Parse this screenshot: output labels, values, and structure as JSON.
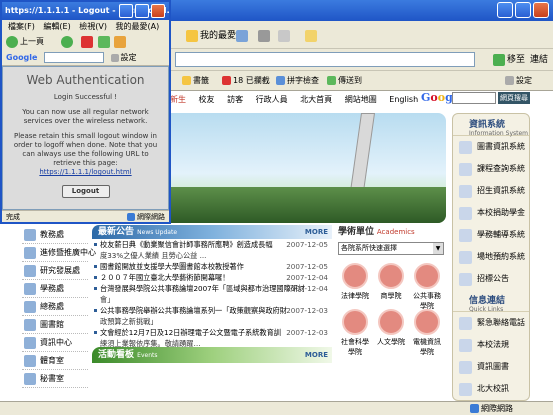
{
  "main_window": {
    "title": "",
    "toolbar": {
      "favorites": "我的最愛",
      "go": "移至",
      "links": "連結"
    },
    "links_bar": {
      "bookmarks": "書籤",
      "blocked": "18 已攔截",
      "spellcheck": "拼字檢查",
      "send_to": "傳送到",
      "settings": "設定"
    },
    "page": {
      "topnav": [
        "新生",
        "校友",
        "訪客",
        "行政人員",
        "北大首頁",
        "網站地圖",
        "English"
      ],
      "google_btn": "網頁搜尋",
      "news": {
        "title": "最新公告",
        "subtitle": "News Update",
        "more": "MORE",
        "items": [
          {
            "text": "校友薪日典《動業聚信會計師事務所應聘》創造成長幅",
            "date": "2007-12-05"
          },
          {
            "text": "度33%之優人業績 且勞心公益 ...",
            "date": ""
          },
          {
            "text": "國書館開放並支援學大學圖書館本校教授著作",
            "date": "2007-12-05"
          },
          {
            "text": "２００７年國立臺北大學藝術節開幕囉！",
            "date": "2007-12-04"
          },
          {
            "text": "台灣發展與學院公共事務論壇2007年「區域與都市治理國際研討",
            "date": "2007-12-04"
          },
          {
            "text": "會」",
            "date": ""
          },
          {
            "text": "公共事務學院舉辦公共事務論壇系列一「政策觀察與政府財",
            "date": "2007-12-03"
          },
          {
            "text": "政預算之新挑戰」",
            "date": ""
          },
          {
            "text": "文會經於12月7日及12日辦理電子公文暨電子系統教育訓",
            "date": "2007-12-03"
          },
          {
            "text": "練須上業報依序集。敬請踴躍…",
            "date": ""
          }
        ]
      },
      "events": {
        "title": "活動看板",
        "subtitle": "Events",
        "more": "MORE"
      },
      "academics": {
        "title": "學術單位",
        "subtitle": "Academics",
        "select": "各院系所快速選擇",
        "cells": [
          "法律學院",
          "商學院",
          "公共事務學院",
          "社會科學學院",
          "人文學院",
          "電機資訊學院"
        ]
      },
      "left_sidebar": [
        "教務處",
        "進修暨推廣中心",
        "研究發展處",
        "學務處",
        "總務處",
        "圖書館",
        "資訊中心",
        "體育室",
        "秘書室"
      ],
      "right_sidebar": {
        "info_title": "資訊系統",
        "info_sub": "Information System",
        "info_items": [
          "圖書資訊系統",
          "課程查詢系統",
          "招生資訊系統",
          "本校捐助學金",
          "學務輔導系統",
          "場地預約系統",
          "招標公告"
        ],
        "links_title": "信息連結",
        "links_sub": "Quick Links",
        "links_items": [
          "緊急聯絡電話",
          "本校法規",
          "資訊圖書",
          "北大校訊"
        ]
      }
    },
    "status": {
      "zone": "網際網路"
    }
  },
  "popup": {
    "title": "https://1.1.1.1 - Logout - Microsoft I...",
    "menu": [
      "檔案(F)",
      "編輯(E)",
      "檢視(V)",
      "我的最愛(A)"
    ],
    "back": "上一頁",
    "google": "Google",
    "settings": "設定",
    "heading": "Web Authentication",
    "success": "Login Successful !",
    "info1": "You can now use all regular network services over the wireless network.",
    "info2": "Please retain this small logout window in order to logoff when done. Note that you can always use the following URL to retrieve this page:",
    "url": "https://1.1.1.1/logout.html",
    "logout_btn": "Logout",
    "status": "完成",
    "zone": "網際網路"
  }
}
